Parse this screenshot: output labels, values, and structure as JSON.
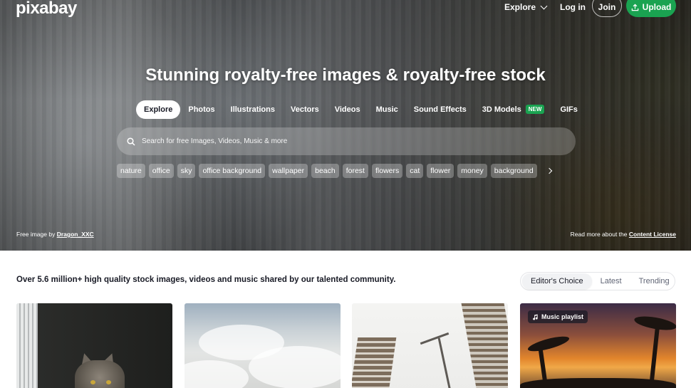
{
  "header": {
    "logo": "pixabay",
    "explore_label": "Explore",
    "login_label": "Log in",
    "join_label": "Join",
    "upload_label": "Upload"
  },
  "hero": {
    "headline": "Stunning royalty-free images & royalty-free stock",
    "categories": [
      {
        "label": "Explore",
        "active": true
      },
      {
        "label": "Photos"
      },
      {
        "label": "Illustrations"
      },
      {
        "label": "Vectors"
      },
      {
        "label": "Videos"
      },
      {
        "label": "Music"
      },
      {
        "label": "Sound Effects"
      },
      {
        "label": "3D Models",
        "badge": "NEW"
      },
      {
        "label": "GIFs"
      }
    ],
    "search_placeholder": "Search for free Images, Videos, Music & more",
    "tags": [
      "nature",
      "office",
      "sky",
      "office background",
      "wallpaper",
      "beach",
      "forest",
      "flowers",
      "cat",
      "flower",
      "money",
      "background"
    ],
    "credit_prefix": "Free image by",
    "credit_author": "Dragon_XXC",
    "license_prefix": "Read more about the",
    "license_link": "Content License"
  },
  "main": {
    "intro": "Over 5.6 million+ high quality stock images, videos and music shared by our talented community.",
    "filters": [
      {
        "label": "Editor's Choice",
        "active": true
      },
      {
        "label": "Latest"
      },
      {
        "label": "Trending"
      }
    ],
    "music_badge": "Music playlist"
  },
  "colors": {
    "brand_green": "#1aa351",
    "text_dark": "#191b26"
  }
}
